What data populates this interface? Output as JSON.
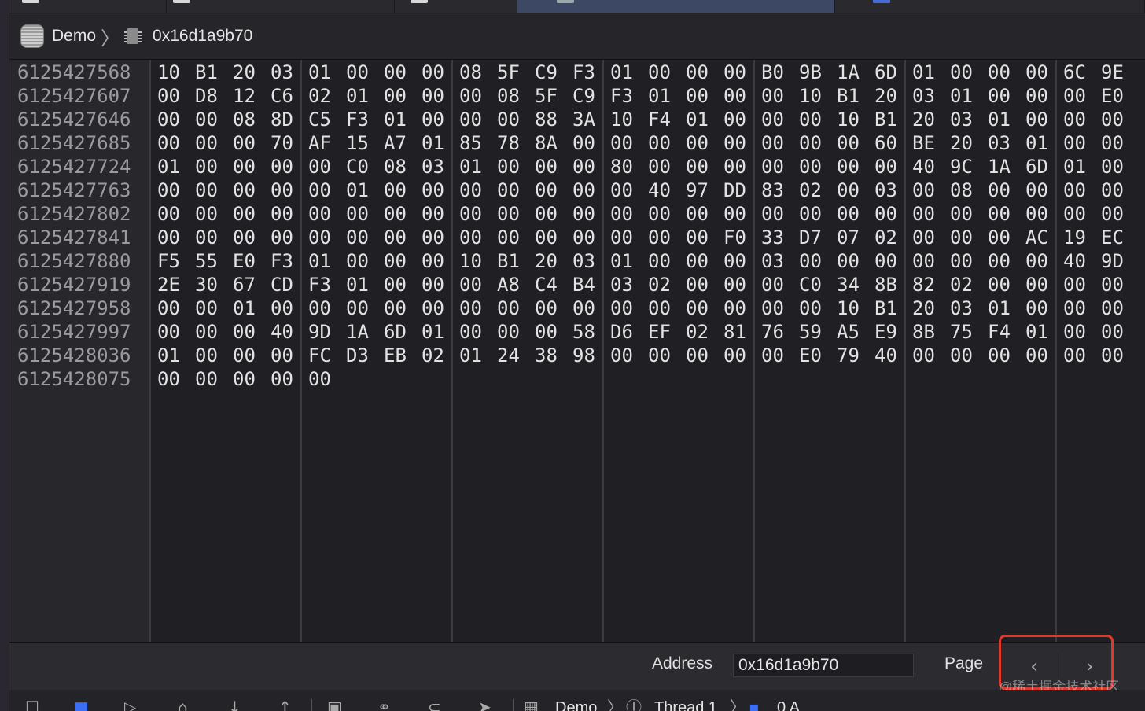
{
  "breadcrumb": {
    "app_name": "Demo",
    "memory_label": "0x16d1a9b70",
    "app_icon": "app-icon",
    "memory_icon": "memory-chip-icon"
  },
  "memory": {
    "addresses": [
      "6125427568",
      "6125427607",
      "6125427646",
      "6125427685",
      "6125427724",
      "6125427763",
      "6125427802",
      "6125427841",
      "6125427880",
      "6125427919",
      "6125427958",
      "6125427997",
      "6125428036",
      "6125428075"
    ],
    "rows": [
      [
        "10 B1 20 03",
        "01 00 00 00",
        "08 5F C9 F3",
        "01 00 00 00",
        "B0 9B 1A 6D",
        "01 00 00 00",
        "6C 9E"
      ],
      [
        "00 D8 12 C6",
        "02 01 00 00",
        "00 08 5F C9",
        "F3 01 00 00",
        "00 10 B1 20",
        "03 01 00 00",
        "00 E0"
      ],
      [
        "00 00 08 8D",
        "C5 F3 01 00",
        "00 00 88 3A",
        "10 F4 01 00",
        "00 00 10 B1",
        "20 03 01 00",
        "00 00"
      ],
      [
        "00 00 00 70",
        "AF 15 A7 01",
        "85 78 8A 00",
        "00 00 00 00",
        "00 00 00 60",
        "BE 20 03 01",
        "00 00"
      ],
      [
        "01 00 00 00",
        "00 C0 08 03",
        "01 00 00 00",
        "80 00 00 00",
        "00 00 00 00",
        "40 9C 1A 6D",
        "01 00"
      ],
      [
        "00 00 00 00",
        "00 01 00 00",
        "00 00 00 00",
        "00 40 97 DD",
        "83 02 00 03",
        "00 08 00 00",
        "00 00"
      ],
      [
        "00 00 00 00",
        "00 00 00 00",
        "00 00 00 00",
        "00 00 00 00",
        "00 00 00 00",
        "00 00 00 00",
        "00 00"
      ],
      [
        "00 00 00 00",
        "00 00 00 00",
        "00 00 00 00",
        "00 00 00 F0",
        "33 D7 07 02",
        "00 00 00 AC",
        "19 EC"
      ],
      [
        "F5 55 E0 F3",
        "01 00 00 00",
        "10 B1 20 03",
        "01 00 00 00",
        "03 00 00 00",
        "00 00 00 00",
        "40 9D"
      ],
      [
        "2E 30 67 CD",
        "F3 01 00 00",
        "00 A8 C4 B4",
        "03 02 00 00",
        "00 C0 34 8B",
        "82 02 00 00",
        "00 00"
      ],
      [
        "00 00 01 00",
        "00 00 00 00",
        "00 00 00 00",
        "00 00 00 00",
        "00 00 10 B1",
        "20 03 01 00",
        "00 00"
      ],
      [
        "00 00 00 40",
        "9D 1A 6D 01",
        "00 00 00 58",
        "D6 EF 02 81",
        "76 59 A5 E9",
        "8B 75 F4 01",
        "00 00"
      ],
      [
        "01 00 00 00",
        "FC D3 EB 02",
        "01 24 38 98",
        "00 00 00 00",
        "00 E0 79 40",
        "00 00 00 00",
        "00 00"
      ],
      [
        "00 00 00 00",
        "00"
      ]
    ]
  },
  "footer": {
    "address_label": "Address",
    "address_value": "0x16d1a9b70",
    "page_label": "Page",
    "prev_symbol": "‹",
    "next_symbol": "›",
    "highlight_color": "#e2382a",
    "watermark": "@稀土掘金技术社区"
  },
  "debug_bar": {
    "crumbs": [
      "Demo",
      "Thread 1",
      "0 A"
    ],
    "icons": [
      "breakpoints-toggle-icon",
      "continue-icon",
      "step-over-icon",
      "step-into-icon",
      "step-out-icon",
      "view-hierarchy-icon",
      "memory-graph-icon",
      "environment-overrides-icon",
      "simulate-location-icon"
    ]
  }
}
